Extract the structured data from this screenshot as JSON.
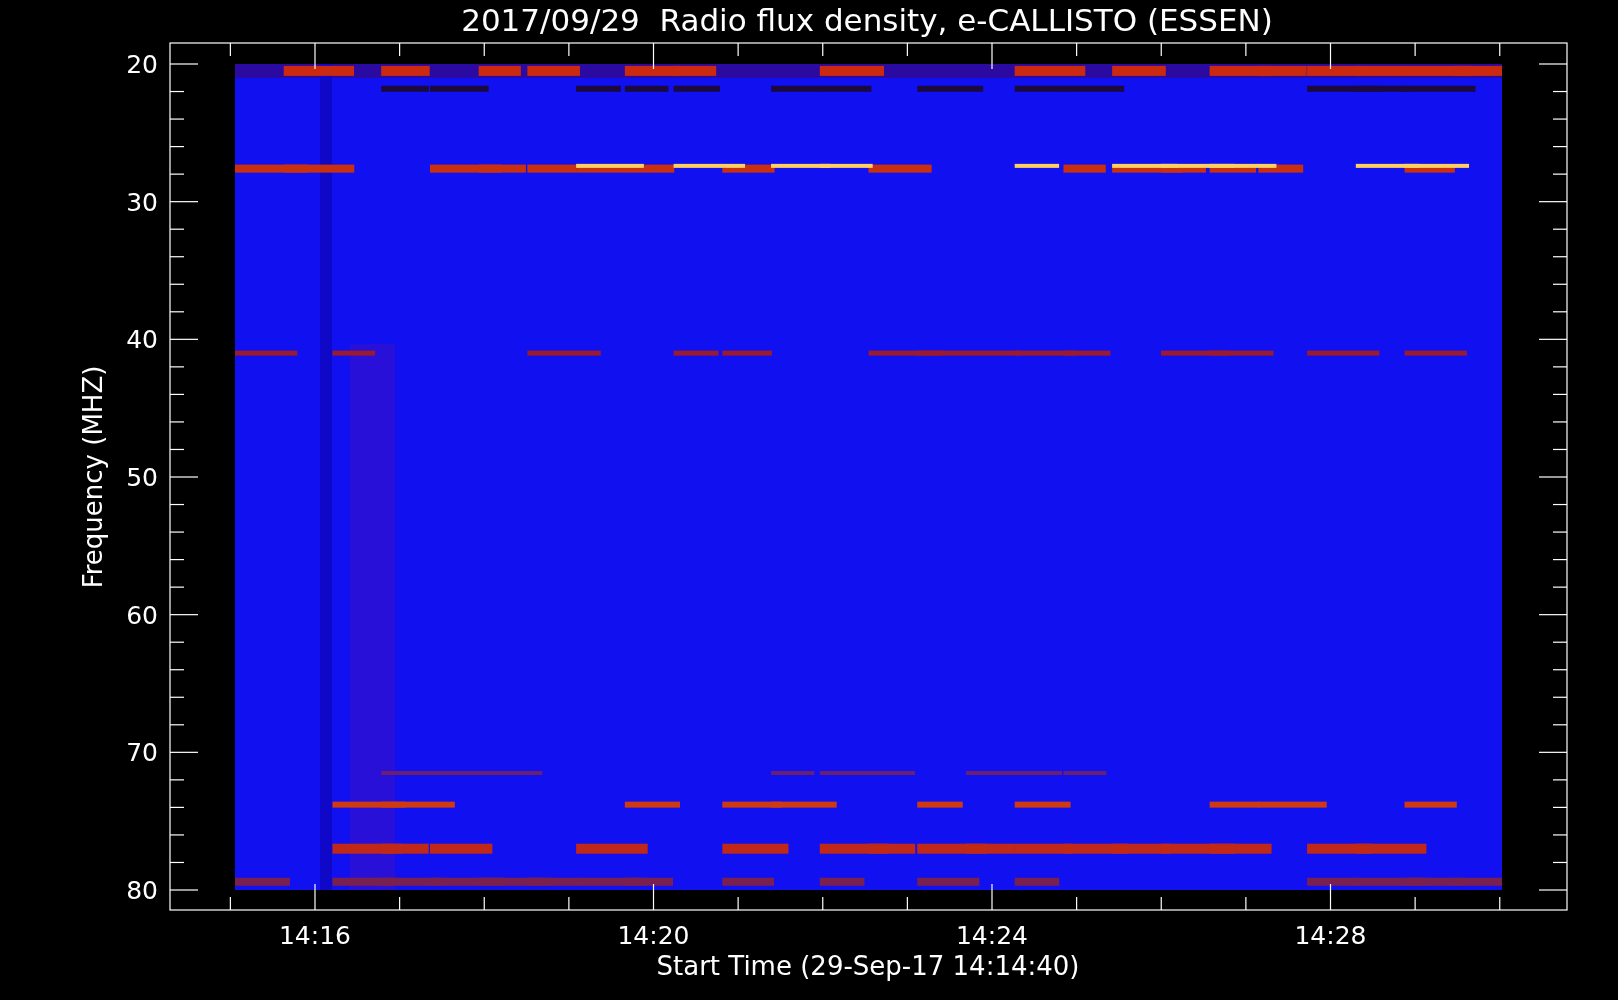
{
  "title": "2017/09/29  Radio flux density, e-CALLISTO (ESSEN)",
  "y_axis": {
    "label": "Frequency (MHZ)",
    "ticks": [
      "20",
      "30",
      "40",
      "50",
      "60",
      "70",
      "80"
    ]
  },
  "x_axis": {
    "label": "Start Time (29-Sep-17 14:14:40)",
    "ticks": [
      "14:16",
      "14:20",
      "14:24",
      "14:28"
    ]
  }
}
